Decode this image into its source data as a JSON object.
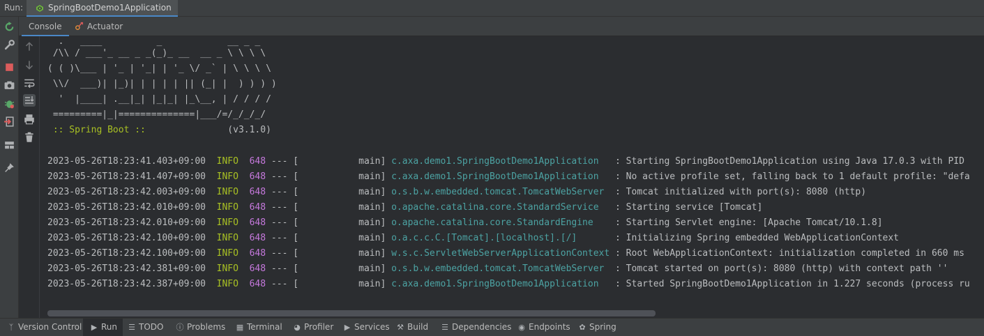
{
  "runbar": {
    "label": "Run:",
    "tab_title": "SpringBootDemo1Application"
  },
  "subtabs": {
    "console": "Console",
    "actuator": "Actuator"
  },
  "banner": [
    "  .   ____          _            __ _ _",
    " /\\\\ / ___'_ __ _ _(_)_ __  __ _ \\ \\ \\ \\",
    "( ( )\\___ | '_ | '_| | '_ \\/ _` | \\ \\ \\ \\",
    " \\\\/  ___)| |_)| | | | | || (_| |  ) ) ) )",
    "  '  |____| .__|_| |_|_| |_\\__, | / / / /",
    " =========|_|==============|___/=/_/_/_/"
  ],
  "spring_boot_line": {
    "label": " :: Spring Boot ::",
    "version": "               (v3.1.0)"
  },
  "logs": [
    {
      "ts": "2023-05-26T18:23:41.403+09:00",
      "level": "INFO",
      "pid": "648",
      "sep": " --- [           main] ",
      "logger": "c.axa.demo1.SpringBootDemo1Application  ",
      "msg": " : Starting SpringBootDemo1Application using Java 17.0.3 with PID"
    },
    {
      "ts": "2023-05-26T18:23:41.407+09:00",
      "level": "INFO",
      "pid": "648",
      "sep": " --- [           main] ",
      "logger": "c.axa.demo1.SpringBootDemo1Application  ",
      "msg": " : No active profile set, falling back to 1 default profile: \"defa"
    },
    {
      "ts": "2023-05-26T18:23:42.003+09:00",
      "level": "INFO",
      "pid": "648",
      "sep": " --- [           main] ",
      "logger": "o.s.b.w.embedded.tomcat.TomcatWebServer ",
      "msg": " : Tomcat initialized with port(s): 8080 (http)"
    },
    {
      "ts": "2023-05-26T18:23:42.010+09:00",
      "level": "INFO",
      "pid": "648",
      "sep": " --- [           main] ",
      "logger": "o.apache.catalina.core.StandardService  ",
      "msg": " : Starting service [Tomcat]"
    },
    {
      "ts": "2023-05-26T18:23:42.010+09:00",
      "level": "INFO",
      "pid": "648",
      "sep": " --- [           main] ",
      "logger": "o.apache.catalina.core.StandardEngine   ",
      "msg": " : Starting Servlet engine: [Apache Tomcat/10.1.8]"
    },
    {
      "ts": "2023-05-26T18:23:42.100+09:00",
      "level": "INFO",
      "pid": "648",
      "sep": " --- [           main] ",
      "logger": "o.a.c.c.C.[Tomcat].[localhost].[/]      ",
      "msg": " : Initializing Spring embedded WebApplicationContext"
    },
    {
      "ts": "2023-05-26T18:23:42.100+09:00",
      "level": "INFO",
      "pid": "648",
      "sep": " --- [           main] ",
      "logger": "w.s.c.ServletWebServerApplicationContext",
      "msg": " : Root WebApplicationContext: initialization completed in 660 ms"
    },
    {
      "ts": "2023-05-26T18:23:42.381+09:00",
      "level": "INFO",
      "pid": "648",
      "sep": " --- [           main] ",
      "logger": "o.s.b.w.embedded.tomcat.TomcatWebServer ",
      "msg": " : Tomcat started on port(s): 8080 (http) with context path ''"
    },
    {
      "ts": "2023-05-26T18:23:42.387+09:00",
      "level": "INFO",
      "pid": "648",
      "sep": " --- [           main] ",
      "logger": "c.axa.demo1.SpringBootDemo1Application  ",
      "msg": " : Started SpringBootDemo1Application in 1.227 seconds (process ru"
    }
  ],
  "bottombar": {
    "version_control": "Version Control",
    "run": "Run",
    "todo": "TODO",
    "problems": "Problems",
    "terminal": "Terminal",
    "profiler": "Profiler",
    "services": "Services",
    "build": "Build",
    "dependencies": "Dependencies",
    "endpoints": "Endpoints",
    "spring": "Spring"
  },
  "colors": {
    "background": "#2b2d30",
    "info": "#a8c023",
    "pid": "#c679dd",
    "logger": "#4ca3a3",
    "accent": "#4a88c7"
  }
}
